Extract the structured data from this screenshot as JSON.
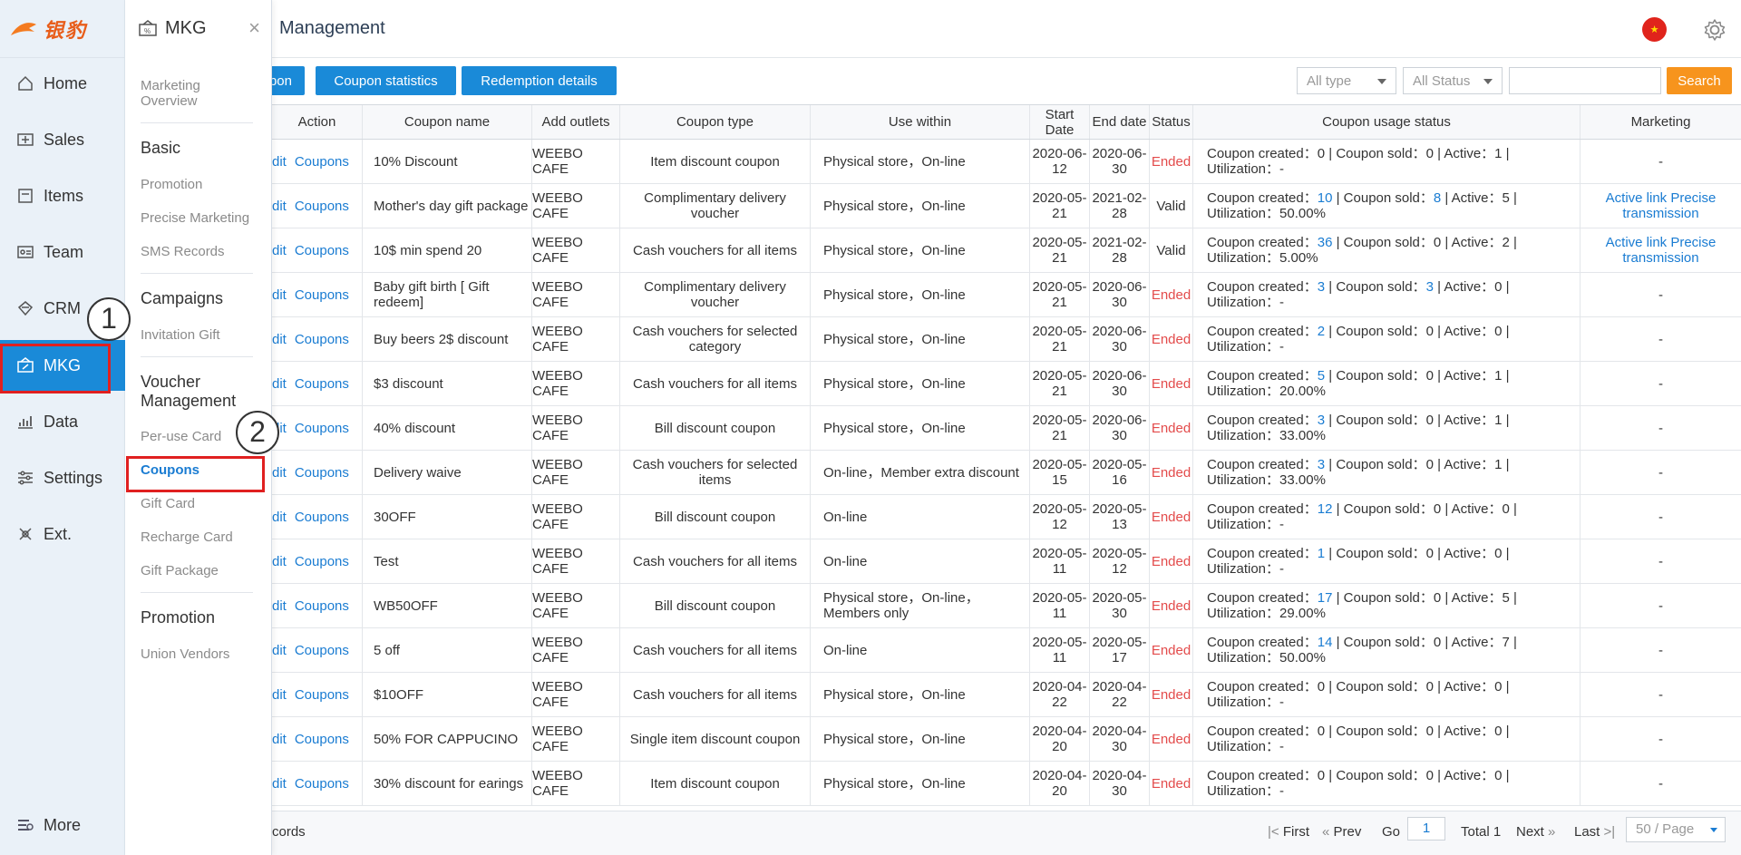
{
  "brand": {
    "logo_text": "银豹"
  },
  "nav": {
    "items": [
      {
        "label": "Home",
        "icon": "home-icon"
      },
      {
        "label": "Sales",
        "icon": "sales-icon"
      },
      {
        "label": "Items",
        "icon": "items-icon"
      },
      {
        "label": "Team",
        "icon": "team-icon"
      },
      {
        "label": "CRM",
        "icon": "crm-icon"
      },
      {
        "label": "MKG",
        "icon": "mkg-icon",
        "active": true
      },
      {
        "label": "Data",
        "icon": "data-icon"
      },
      {
        "label": "Settings",
        "icon": "settings-icon"
      },
      {
        "label": "Ext.",
        "icon": "ext-icon"
      }
    ],
    "more_label": "More"
  },
  "submenu": {
    "title": "MKG",
    "close": "×",
    "overview": "Marketing Overview",
    "basic": "Basic",
    "promotion": "Promotion",
    "precise_marketing": "Precise Marketing",
    "sms_records": "SMS Records",
    "campaigns": "Campaigns",
    "invitation_gift": "Invitation Gift",
    "voucher_management": "Voucher Management",
    "per_use_card": "Per-use Card",
    "coupons": "Coupons",
    "gift_card": "Gift Card",
    "recharge_card": "Recharge Card",
    "gift_package": "Gift Package",
    "promotion2": "Promotion",
    "union_vendors": "Union Vendors"
  },
  "header": {
    "title": "Management",
    "flag_label": "★"
  },
  "toolbar": {
    "btn_partial": "pon",
    "btn_statistics": "Coupon statistics",
    "btn_redemption": "Redemption details",
    "type_select": "All type",
    "status_select": "All Status",
    "search_placeholder": "",
    "search_label": "Search"
  },
  "table": {
    "headers": {
      "action": "Action",
      "name": "Coupon name",
      "outlets": "Add outlets",
      "type": "Coupon type",
      "use": "Use within",
      "start": "Start Date",
      "end": "End date",
      "status": "Status",
      "usage": "Coupon usage status",
      "marketing": "Marketing"
    },
    "action_edit": "dit",
    "action_coupons": "Coupons",
    "rows": [
      {
        "name": "10% Discount",
        "outlet": "WEEBO CAFE",
        "type": "Item discount coupon",
        "use": "Physical store，On-line",
        "start": "2020-06-12",
        "end": "2020-06-30",
        "status": "Ended",
        "created": "0",
        "sold": "0",
        "active": "1",
        "util": "-",
        "mkt": "-"
      },
      {
        "name": "Mother's day gift package",
        "outlet": "WEEBO CAFE",
        "type": "Complimentary delivery voucher",
        "use": "Physical store，On-line",
        "start": "2020-05-21",
        "end": "2021-02-28",
        "status": "Valid",
        "created": "10",
        "sold": "8",
        "active": "5",
        "util": "50.00%",
        "mkt": "Active link  Precise transmission"
      },
      {
        "name": "10$ min spend 20",
        "outlet": "WEEBO CAFE",
        "type": "Cash vouchers for all items",
        "use": "Physical store，On-line",
        "start": "2020-05-21",
        "end": "2021-02-28",
        "status": "Valid",
        "created": "36",
        "sold": "0",
        "active": "2",
        "util": "5.00%",
        "mkt": "Active link  Precise transmission"
      },
      {
        "name": "Baby gift birth [ Gift redeem]",
        "outlet": "WEEBO CAFE",
        "type": "Complimentary delivery voucher",
        "use": "Physical store，On-line",
        "start": "2020-05-21",
        "end": "2020-06-30",
        "status": "Ended",
        "created": "3",
        "sold": "3",
        "active": "0",
        "util": "-",
        "mkt": "-"
      },
      {
        "name": "Buy beers 2$ discount",
        "outlet": "WEEBO CAFE",
        "type": "Cash vouchers for selected category",
        "use": "Physical store，On-line",
        "start": "2020-05-21",
        "end": "2020-06-30",
        "status": "Ended",
        "created": "2",
        "sold": "0",
        "active": "0",
        "util": "-",
        "mkt": "-"
      },
      {
        "name": "$3 discount",
        "outlet": "WEEBO CAFE",
        "type": "Cash vouchers for all items",
        "use": "Physical store，On-line",
        "start": "2020-05-21",
        "end": "2020-06-30",
        "status": "Ended",
        "created": "5",
        "sold": "0",
        "active": "1",
        "util": "20.00%",
        "mkt": "-"
      },
      {
        "name": "40% discount",
        "outlet": "WEEBO CAFE",
        "type": "Bill discount coupon",
        "use": "Physical store，On-line",
        "start": "2020-05-21",
        "end": "2020-06-30",
        "status": "Ended",
        "created": "3",
        "sold": "0",
        "active": "1",
        "util": "33.00%",
        "mkt": "-"
      },
      {
        "name": "Delivery waive",
        "outlet": "WEEBO CAFE",
        "type": "Cash vouchers for selected items",
        "use": "On-line，Member extra discount",
        "start": "2020-05-15",
        "end": "2020-05-16",
        "status": "Ended",
        "created": "3",
        "sold": "0",
        "active": "1",
        "util": "33.00%",
        "mkt": "-"
      },
      {
        "name": "30OFF",
        "outlet": "WEEBO CAFE",
        "type": "Bill discount coupon",
        "use": "On-line",
        "start": "2020-05-12",
        "end": "2020-05-13",
        "status": "Ended",
        "created": "12",
        "sold": "0",
        "active": "0",
        "util": "-",
        "mkt": "-"
      },
      {
        "name": "Test",
        "outlet": "WEEBO CAFE",
        "type": "Cash vouchers for all items",
        "use": "On-line",
        "start": "2020-05-11",
        "end": "2020-05-12",
        "status": "Ended",
        "created": "1",
        "sold": "0",
        "active": "0",
        "util": "-",
        "mkt": "-"
      },
      {
        "name": "WB50OFF",
        "outlet": "WEEBO CAFE",
        "type": "Bill discount coupon",
        "use": "Physical store，On-line，Members only",
        "start": "2020-05-11",
        "end": "2020-05-30",
        "status": "Ended",
        "created": "17",
        "sold": "0",
        "active": "5",
        "util": "29.00%",
        "mkt": "-"
      },
      {
        "name": "5 off",
        "outlet": "WEEBO CAFE",
        "type": "Cash vouchers for all items",
        "use": "On-line",
        "start": "2020-05-11",
        "end": "2020-05-17",
        "status": "Ended",
        "created": "14",
        "sold": "0",
        "active": "7",
        "util": "50.00%",
        "mkt": "-"
      },
      {
        "name": "$10OFF",
        "outlet": "WEEBO CAFE",
        "type": "Cash vouchers for all items",
        "use": "Physical store，On-line",
        "start": "2020-04-22",
        "end": "2020-04-22",
        "status": "Ended",
        "created": "0",
        "sold": "0",
        "active": "0",
        "util": "-",
        "mkt": "-"
      },
      {
        "name": "50% FOR CAPPUCINO",
        "outlet": "WEEBO CAFE",
        "type": "Single item discount coupon",
        "use": "Physical store，On-line",
        "start": "2020-04-20",
        "end": "2020-04-30",
        "status": "Ended",
        "created": "0",
        "sold": "0",
        "active": "0",
        "util": "-",
        "mkt": "-"
      },
      {
        "name": "30% discount for earings",
        "outlet": "WEEBO CAFE",
        "type": "Item discount coupon",
        "use": "Physical store，On-line",
        "start": "2020-04-20",
        "end": "2020-04-30",
        "status": "Ended",
        "created": "0",
        "sold": "0",
        "active": "0",
        "util": "-",
        "mkt": "-"
      }
    ]
  },
  "usage_labels": {
    "created": "Coupon created：",
    "sold": "Coupon sold：",
    "active": "Active：",
    "util": "Utilization：",
    "sep": " | "
  },
  "footer": {
    "records": "cords",
    "first": "First",
    "prev": "Prev",
    "go": "Go",
    "page": "1",
    "total": "Total 1",
    "next": "Next",
    "last": "Last",
    "page_size": "50 / Page"
  },
  "annotations": {
    "step1": "1",
    "step2": "2"
  },
  "colors": {
    "accent": "#1a8ad8",
    "ended": "#e34b4b",
    "search": "#f7941d",
    "highlight": "#e02020"
  }
}
